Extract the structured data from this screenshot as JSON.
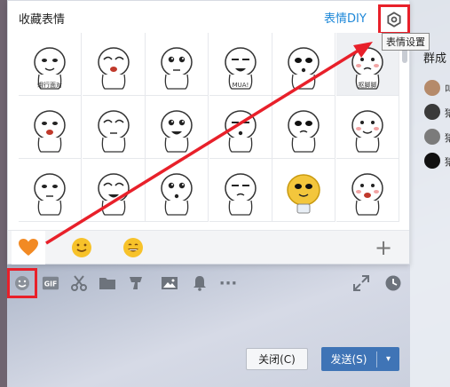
{
  "panel": {
    "title": "收藏表情",
    "diy_label": "表情DIY",
    "settings_tooltip": "表情设置"
  },
  "stickers": [
    {
      "row": 0,
      "col": 0,
      "caption": "蛾行面对"
    },
    {
      "row": 0,
      "col": 1,
      "caption": ""
    },
    {
      "row": 0,
      "col": 2,
      "caption": ""
    },
    {
      "row": 0,
      "col": 3,
      "caption": "MUA!"
    },
    {
      "row": 0,
      "col": 4,
      "caption": ""
    },
    {
      "row": 0,
      "col": 5,
      "caption": "抠脚脚",
      "selected": true
    },
    {
      "row": 1,
      "col": 0,
      "caption": ""
    },
    {
      "row": 1,
      "col": 1,
      "caption": ""
    },
    {
      "row": 1,
      "col": 2,
      "caption": ""
    },
    {
      "row": 1,
      "col": 3,
      "caption": ""
    },
    {
      "row": 1,
      "col": 4,
      "caption": ""
    },
    {
      "row": 1,
      "col": 5,
      "caption": ""
    },
    {
      "row": 2,
      "col": 0,
      "caption": ""
    },
    {
      "row": 2,
      "col": 1,
      "caption": ""
    },
    {
      "row": 2,
      "col": 2,
      "caption": ""
    },
    {
      "row": 2,
      "col": 3,
      "caption": ""
    },
    {
      "row": 2,
      "col": 4,
      "caption": ""
    },
    {
      "row": 2,
      "col": 5,
      "caption": ""
    }
  ],
  "emoji_tabs": [
    {
      "name": "favorites-heart-icon",
      "color": "#f28a24",
      "active": true
    },
    {
      "name": "smiley-face-icon",
      "color": "#f7c22a",
      "active": false
    },
    {
      "name": "grin-face-icon",
      "color": "#f7c22a",
      "active": false
    }
  ],
  "add_tab_label": "+",
  "toolbar": {
    "gif_label": "GIF",
    "more_label": "···"
  },
  "right_panel": {
    "title": "群成",
    "members": [
      {
        "name": "叫",
        "color": "#b58a6a"
      },
      {
        "name": "猿",
        "color": "#3a3a3a"
      },
      {
        "name": "猿",
        "color": "#7b7b7b"
      },
      {
        "name": "猿",
        "color": "#111111"
      }
    ]
  },
  "buttons": {
    "close_label": "关闭(C)",
    "send_label": "发送(S)",
    "send_dropdown": "▾"
  },
  "colors": {
    "accent": "#1e88d8",
    "highlight_red": "#e8202a",
    "send_button": "#3f74b6"
  }
}
